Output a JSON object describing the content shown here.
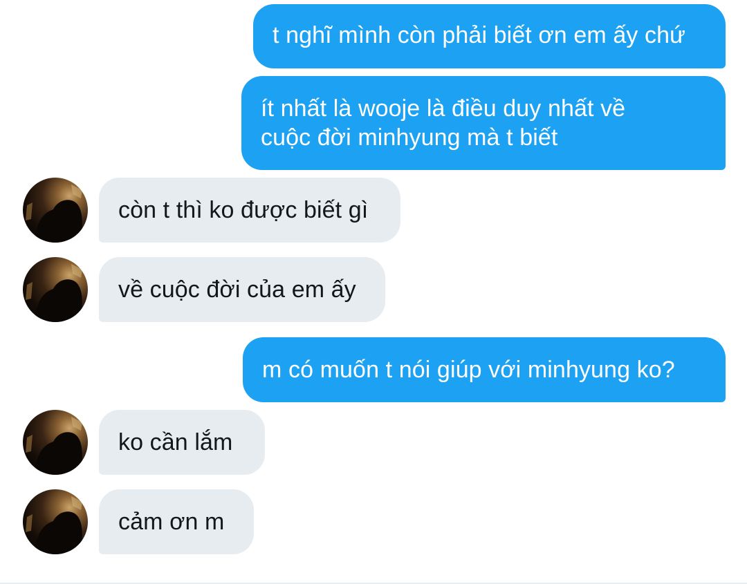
{
  "conversation": {
    "messages": [
      {
        "direction": "sent",
        "text": "t nghĩ mình còn phải biết ơn em ấy chứ"
      },
      {
        "direction": "sent",
        "lines": [
          "ít nhất là wooje là điều duy nhất về",
          "cuộc đời minhyung mà t biết"
        ]
      },
      {
        "direction": "received",
        "text": "còn t thì ko được biết gì"
      },
      {
        "direction": "received",
        "text": "về cuộc đời của em ấy"
      },
      {
        "direction": "sent",
        "text": "m có muốn t nói giúp với minhyung ko?"
      },
      {
        "direction": "received",
        "text": "ko cần lắm"
      },
      {
        "direction": "received",
        "text": "cảm ơn m"
      }
    ]
  },
  "colors": {
    "sent_bubble": "#1da1f2",
    "received_bubble": "#e6ecf0",
    "sent_text": "#ffffff",
    "received_text": "#14171a"
  }
}
